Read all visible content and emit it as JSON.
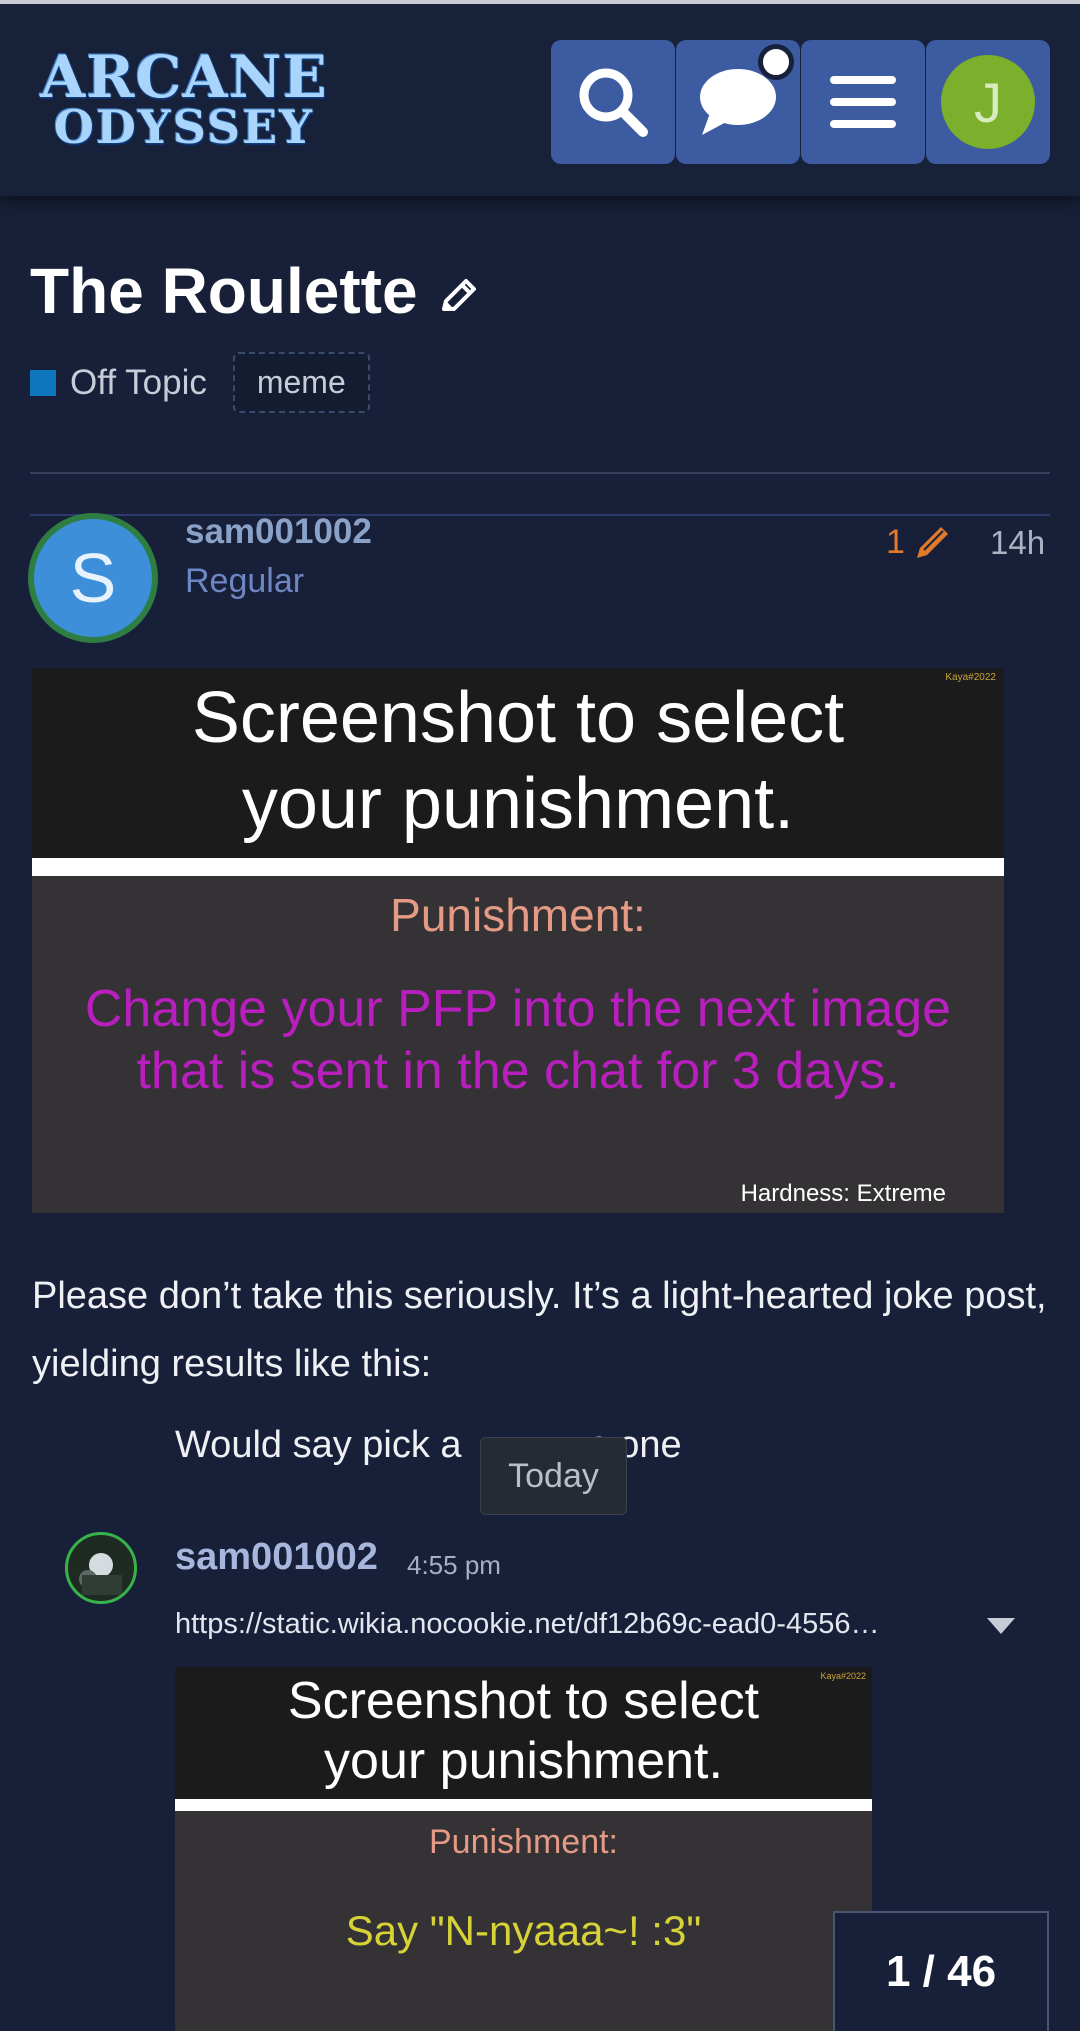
{
  "header": {
    "logo_line1": "ARCANE",
    "logo_line2": "ODYSSEY",
    "search_icon": "search-icon",
    "chat_icon": "chat-bubble-icon",
    "menu_icon": "hamburger-menu-icon",
    "user_avatar_letter": "J",
    "accent": "#3d5ba0"
  },
  "topic": {
    "title": "The Roulette",
    "category": "Off Topic",
    "category_color": "#0e76bd",
    "tag": "meme"
  },
  "post": {
    "avatar_letter": "S",
    "username": "sam001002",
    "user_title": "Regular",
    "edit_count": "1",
    "age": "14h",
    "image": {
      "watermark": "Kaya#2022",
      "heading_line1": "Screenshot to select",
      "heading_line2": "your punishment.",
      "punishment_label": "Punishment:",
      "punishment_line1": "Change your PFP into the next image",
      "punishment_line2": "that is sent in the chat for 3 days.",
      "hardness": "Hardness: Extreme"
    },
    "body": "Please don’t take this seriously. It’s a light-hearted joke post, yielding results like this:",
    "quote_left": "Would say pick a",
    "quote_right": "n one",
    "date_tooltip": "Today",
    "chat": {
      "username": "sam001002",
      "time": "4:55 pm",
      "link": "https://static.wikia.nocookie.net/df12b69c-ead0-4556…",
      "image": {
        "watermark": "Kaya#2022",
        "heading_line1": "Screenshot to select",
        "heading_line2": "your punishment.",
        "punishment_label": "Punishment:",
        "punishment_text": "Say \"N-nyaaa~! :3\""
      }
    }
  },
  "progress": "1 / 46"
}
